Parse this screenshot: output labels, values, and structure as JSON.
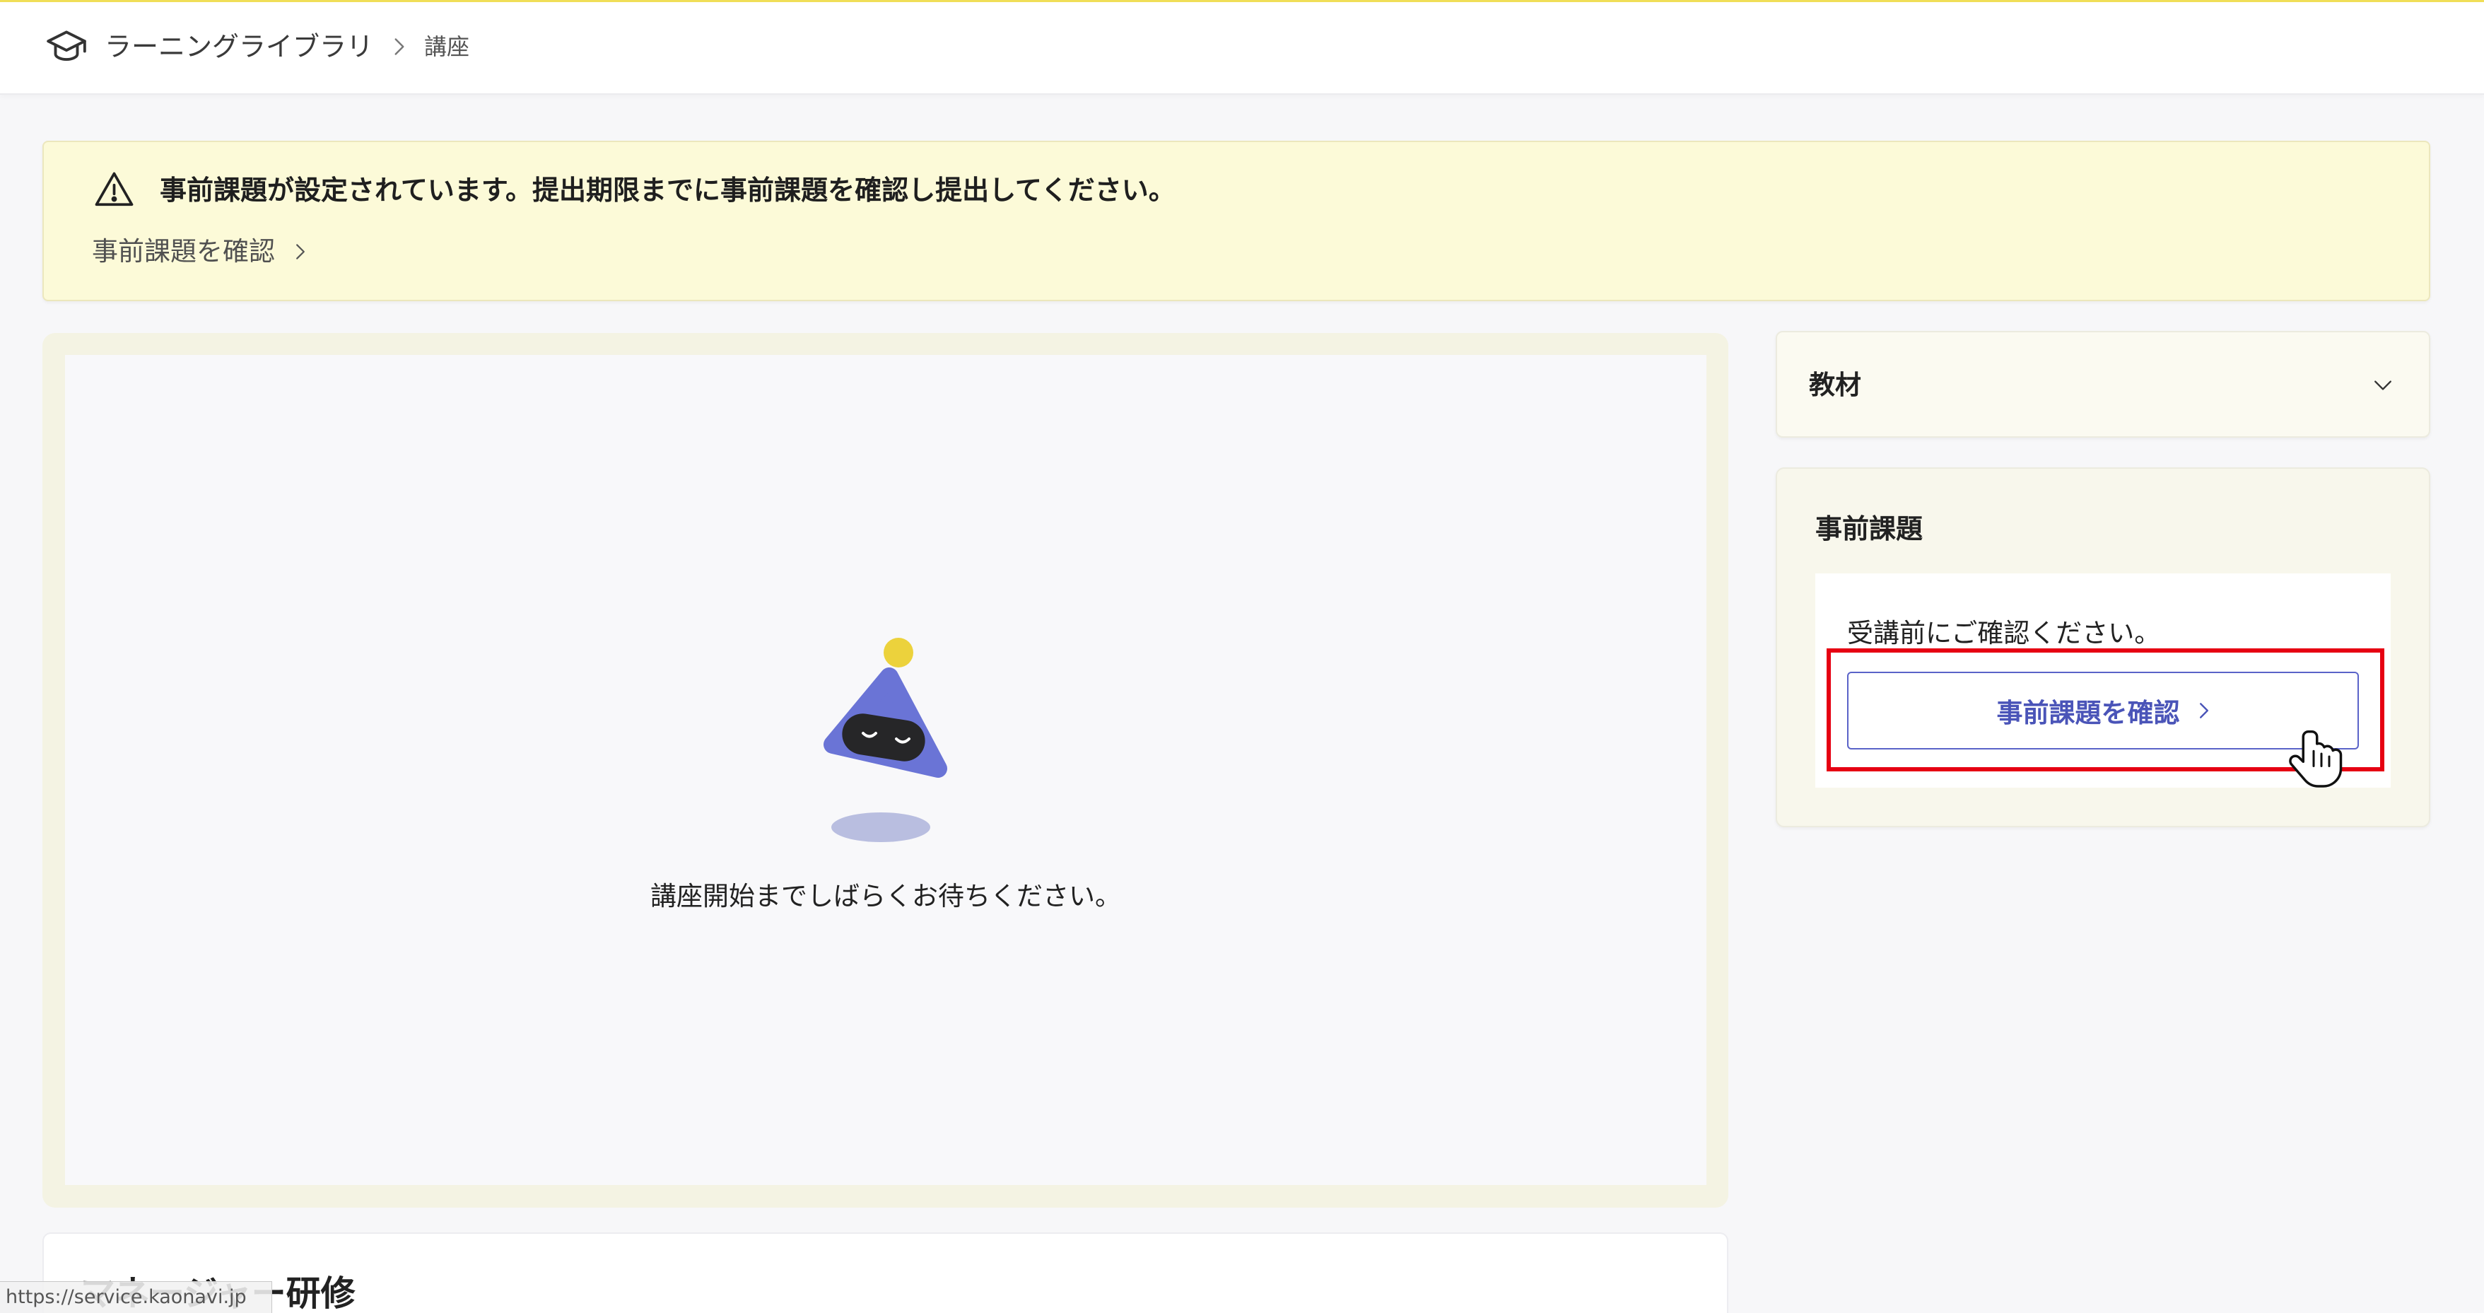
{
  "header": {
    "app_title": "ラーニングライブラリ",
    "current_page": "講座",
    "icons": {
      "logo": "graduation-cap-icon",
      "separator": "chevron-right-icon"
    }
  },
  "alert": {
    "message": "事前課題が設定されています。提出期限までに事前課題を確認し提出してください。",
    "link_label": "事前課題を確認",
    "icon": "warning-icon",
    "link_icon": "chevron-right-icon"
  },
  "player": {
    "waiting_message": "講座開始までしばらくお待ちください。",
    "illustration": "mascot-illustration"
  },
  "course": {
    "title": "マネージャー研修"
  },
  "sidebar": {
    "materials": {
      "title": "教材",
      "icon": "chevron-down-icon"
    },
    "pre_assignment": {
      "title": "事前課題",
      "note": "受講前にご確認ください。",
      "button_label": "事前課題を確認",
      "button_icon": "chevron-right-icon"
    }
  },
  "overlay": {
    "cursor": "hand-cursor-icon"
  },
  "status_bar": {
    "url": "https://service.kaonavi.jp"
  },
  "colors": {
    "accent_line": "#f0de57",
    "alert_background": "#fcfad8",
    "primary": "#4a54b8",
    "highlight": "#e60012",
    "mascot_body": "#6a74d6",
    "mascot_ball": "#ecd23c"
  }
}
